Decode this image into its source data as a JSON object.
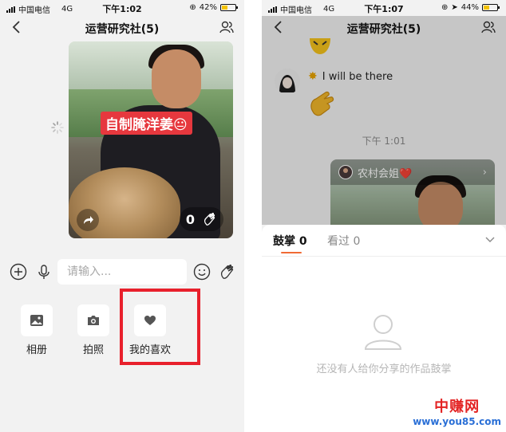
{
  "left": {
    "status": {
      "carrier": "中国电信",
      "network": "4G",
      "time": "下午1:02",
      "battery": "42%",
      "battery_level": 0.42
    },
    "title": "运营研究社(5)",
    "video": {
      "caption": "自制腌洋姜😐",
      "likes": "0"
    },
    "input": {
      "placeholder": "请输入..."
    },
    "panel": [
      {
        "label": "相册",
        "icon": "photo-album-icon"
      },
      {
        "label": "拍照",
        "icon": "camera-icon"
      },
      {
        "label": "我的喜欢",
        "icon": "heart-icon"
      }
    ]
  },
  "right": {
    "status": {
      "carrier": "中国电信",
      "network": "4G",
      "time": "下午1:07",
      "battery": "44%",
      "battery_level": 0.44
    },
    "title": "运营研究社(5)",
    "chat": {
      "message": "I will be there",
      "time": "下午 1:01",
      "card_user": "农村会姐❤️"
    },
    "sheet": {
      "tabs": [
        {
          "label": "鼓掌 0"
        },
        {
          "label": "看过 0"
        }
      ],
      "empty_text": "还没有人给你分享的作品鼓掌"
    }
  },
  "watermark": {
    "logo": "中赚网",
    "url": "www.you85.com"
  },
  "colors": {
    "accent": "#f06a34",
    "highlight": "#e8202c",
    "caption_bg": "#e6383e"
  }
}
